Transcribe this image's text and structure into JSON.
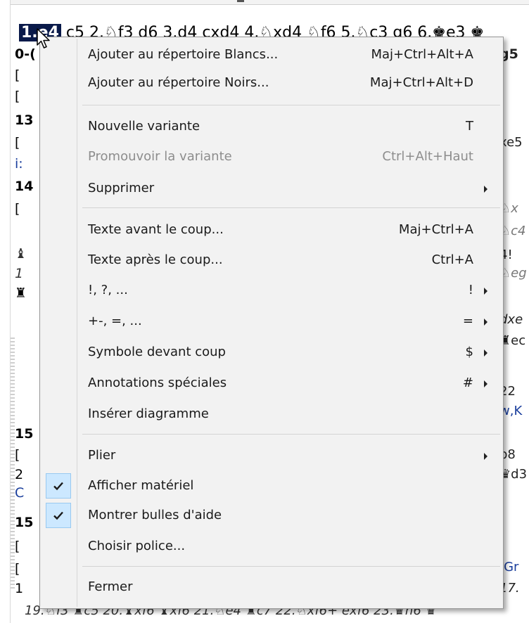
{
  "notation": {
    "move_line_highlight": "1.e4",
    "move_line_rest": " c5 2.♘f3 d6 3.d4 cxd4 4.♘xd4 ♘f6 5.♘c3 g6 6.♚e3 ♚",
    "left_fragments": [
      "0-(",
      "[",
      "[",
      "13",
      "[",
      "i:",
      "14",
      "[",
      "♝",
      "1",
      "♜",
      "15",
      "[",
      "2",
      "C",
      "15",
      "[",
      "[",
      "1"
    ],
    "right_fragments": [
      "g5",
      "xe5",
      "♘x",
      "♘c4",
      "4!",
      "♘eg",
      "dxe",
      "♜ec",
      "22",
      "w,K",
      "b8",
      "♛d3",
      "/Gr",
      "17."
    ],
    "bottom_line": "19.♘f3 ♜c5 20.♝xf6 ♝xf6 21.♘e4 ♜c7 22.♘xf6+ exf6 23.♛h6 ♛"
  },
  "menu": {
    "items": [
      {
        "label": "Ajouter au répertoire Blancs...",
        "shortcut": "Maj+Ctrl+Alt+A"
      },
      {
        "label": "Ajouter au répertoire Noirs...",
        "shortcut": "Maj+Ctrl+Alt+D"
      },
      {
        "label": "Nouvelle variante",
        "shortcut": "T"
      },
      {
        "label": "Promouvoir la variante",
        "shortcut": "Ctrl+Alt+Haut",
        "disabled": true
      },
      {
        "label": "Supprimer",
        "shortcut": "",
        "submenu": true
      },
      {
        "label": "Texte avant le coup...",
        "shortcut": "Maj+Ctrl+A"
      },
      {
        "label": "Texte après le coup...",
        "shortcut": "Ctrl+A"
      },
      {
        "label": "!, ?, ...",
        "shortcut": "!",
        "submenu": true
      },
      {
        "label": "+-, =, ...",
        "shortcut": "=",
        "submenu": true
      },
      {
        "label": "Symbole devant coup",
        "shortcut": "$",
        "submenu": true
      },
      {
        "label": "Annotations spéciales",
        "shortcut": "#",
        "submenu": true
      },
      {
        "label": "Insérer diagramme",
        "shortcut": ""
      },
      {
        "label": "Plier",
        "shortcut": "",
        "submenu": true
      },
      {
        "label": "Afficher matériel",
        "shortcut": "",
        "checked": true
      },
      {
        "label": "Montrer bulles d'aide",
        "shortcut": "",
        "checked": true
      },
      {
        "label": "Choisir police...",
        "shortcut": ""
      },
      {
        "label": "Fermer",
        "shortcut": ""
      }
    ]
  },
  "icons": {
    "check": "checkmark-icon",
    "submenu": "chevron-right-icon",
    "cursor": "mouse-pointer-icon"
  },
  "colors": {
    "menu_bg": "#f2f2f2",
    "check_bg": "#cce8ff",
    "highlight_move_bg": "#0a1a4a",
    "disabled_text": "#8d8d8d"
  }
}
